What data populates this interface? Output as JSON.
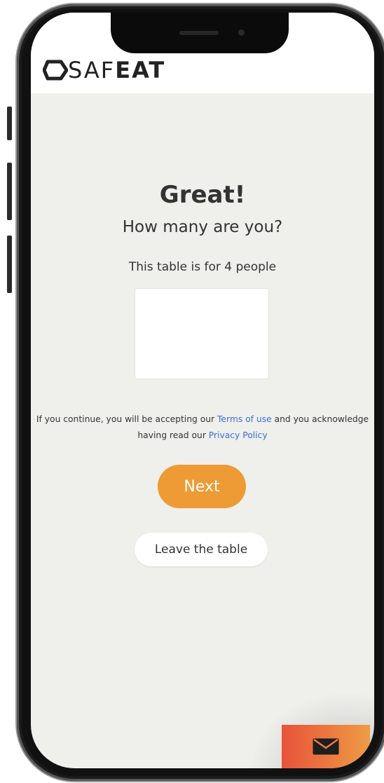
{
  "colors": {
    "background": "#efefec",
    "accent": "#ee9b35",
    "link": "#3a6fd8",
    "mail_button_from": "#e8533a",
    "mail_button_to": "#ee9b45"
  },
  "header": {
    "logo_light": "SAF",
    "logo_bold": "EAT"
  },
  "main": {
    "title": "Great!",
    "subtitle": "How many are you?",
    "table_info": "This table is for 4 people",
    "guest_count_value": ""
  },
  "legal": {
    "text_before": "If you continue, you will be accepting our ",
    "terms_link": "Terms of use",
    "text_between": " and you acknowledge having read our ",
    "privacy_link": "Privacy Policy"
  },
  "actions": {
    "next_label": "Next",
    "leave_label": "Leave the table"
  },
  "icons": {
    "logo": "safeat-logo-icon",
    "mail": "envelope-icon"
  }
}
